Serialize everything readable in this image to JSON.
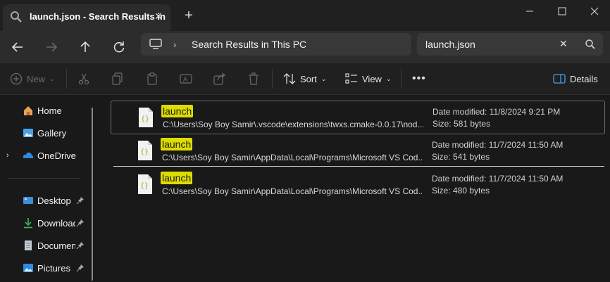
{
  "tab": {
    "title": "launch.json - Search Results in",
    "icon": "search-icon"
  },
  "nav": {
    "address_path": "Search Results in This PC",
    "search_value": "launch.json"
  },
  "toolbar": {
    "new_label": "New",
    "sort_label": "Sort",
    "view_label": "View",
    "details_label": "Details"
  },
  "sidebar": {
    "items": [
      {
        "label": "Home",
        "icon": "home-icon"
      },
      {
        "label": "Gallery",
        "icon": "gallery-icon"
      },
      {
        "label": "OneDrive",
        "icon": "cloud-icon"
      },
      {
        "label": "Desktop",
        "icon": "desktop-icon"
      },
      {
        "label": "Downloads",
        "icon": "download-icon"
      },
      {
        "label": "Documents",
        "icon": "document-icon"
      },
      {
        "label": "Pictures",
        "icon": "pictures-icon"
      }
    ]
  },
  "results": [
    {
      "name": "launch",
      "path": "C:\\Users\\Soy Boy Samir\\.vscode\\extensions\\twxs.cmake-0.0.17\\nod...",
      "modified_label": "Date modified:",
      "modified": "11/8/2024 9:21 PM",
      "size_label": "Size:",
      "size": "581 bytes"
    },
    {
      "name": "launch",
      "path": "C:\\Users\\Soy Boy Samir\\AppData\\Local\\Programs\\Microsoft VS Cod...",
      "modified_label": "Date modified:",
      "modified": "11/7/2024 11:50 AM",
      "size_label": "Size:",
      "size": "541 bytes"
    },
    {
      "name": "launch",
      "path": "C:\\Users\\Soy Boy Samir\\AppData\\Local\\Programs\\Microsoft VS Cod...",
      "modified_label": "Date modified:",
      "modified": "11/7/2024 11:50 AM",
      "size_label": "Size:",
      "size": "480 bytes"
    }
  ],
  "colors": {
    "highlight": "#dedc00",
    "accent": "#4aa0e6"
  }
}
